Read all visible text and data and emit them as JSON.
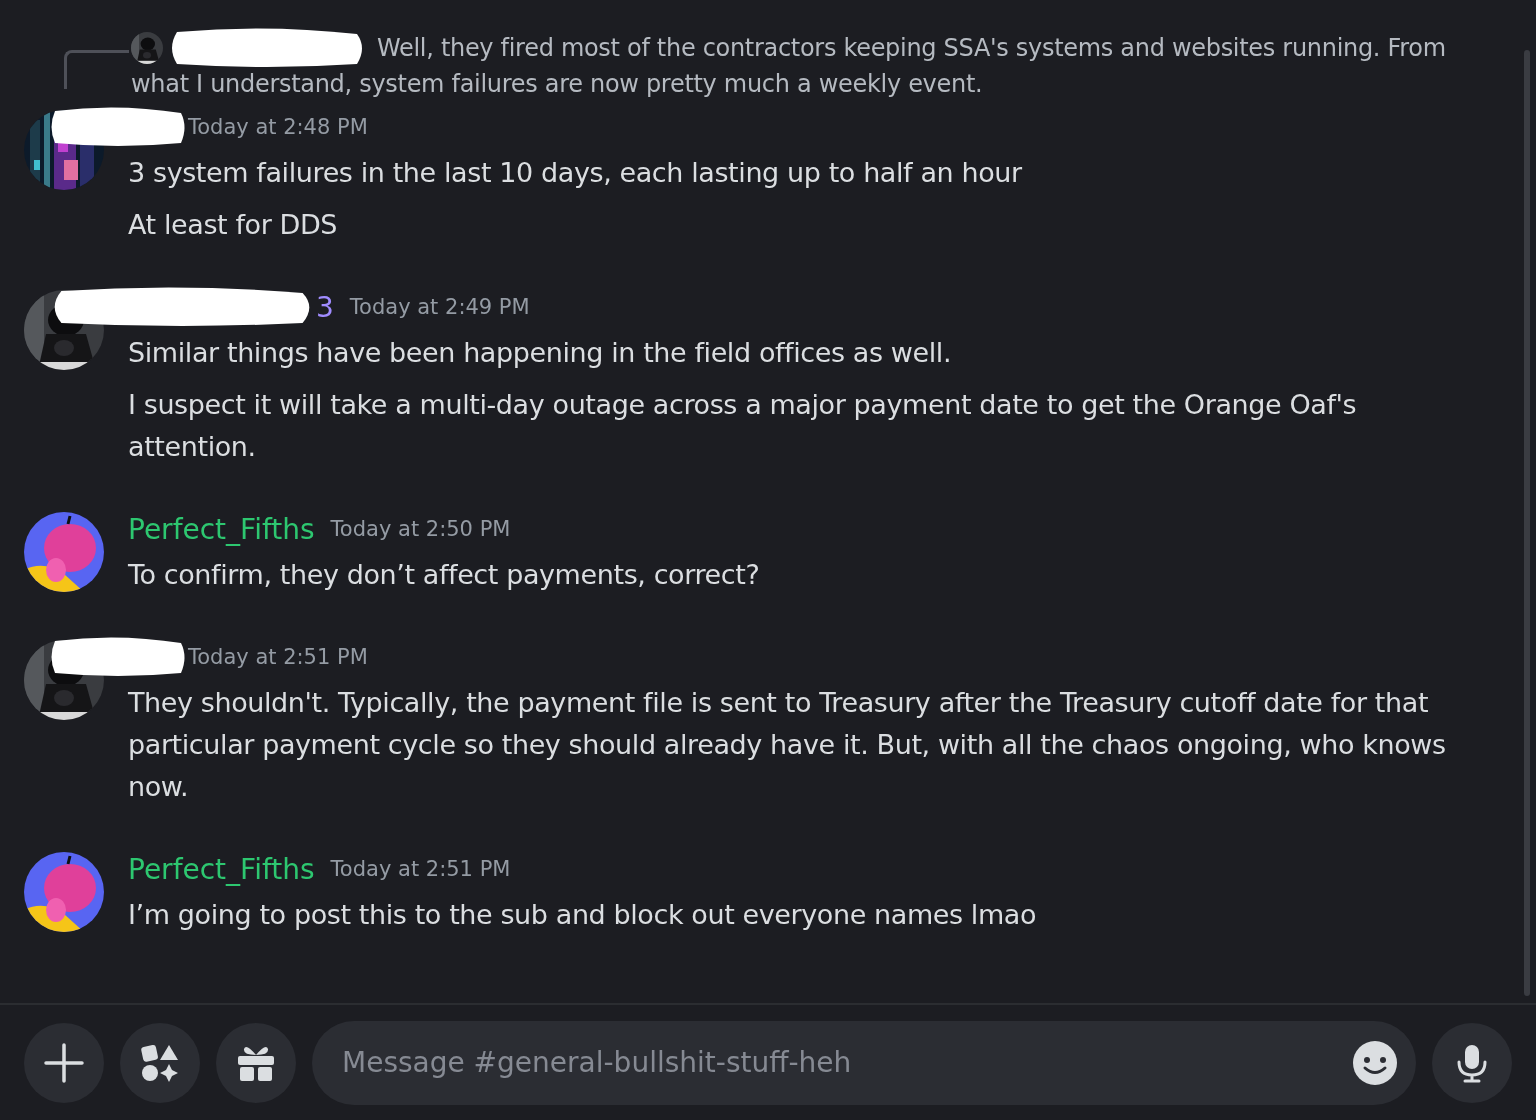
{
  "messages": [
    {
      "reply": {
        "text": "Well, they fired most of the contractors keeping SSA's systems and websites running.   From what I understand, system failures are now pretty much a weekly event.",
        "redacted": true
      },
      "redacted": true,
      "timestamp": "Today at 2:48 PM",
      "lines": [
        "3 system failures in the last 10 days, each lasting up to half an hour",
        "At least for DDS"
      ]
    },
    {
      "redacted": true,
      "author": {
        "name": "3",
        "color": "#a08cff"
      },
      "timestamp": "Today at 2:49 PM",
      "lines": [
        "Similar things have been happening in the field offices as well.",
        "I suspect it will take a multi-day outage across a major payment date to get the Orange Oaf's attention."
      ]
    },
    {
      "redacted": false,
      "author": {
        "name": "Perfect_Fifths",
        "color": "#2dc770"
      },
      "timestamp": "Today at 2:50 PM",
      "lines": [
        "To confirm, they don’t affect payments, correct?"
      ]
    },
    {
      "redacted": true,
      "timestamp": "Today at 2:51 PM",
      "lines": [
        "They shouldn't.   Typically, the payment file is sent to Treasury after the Treasury cutoff date for that particular payment cycle so they should already have it.   But, with all the chaos ongoing, who knows now."
      ]
    },
    {
      "redacted": false,
      "author": {
        "name": "Perfect_Fifths",
        "color": "#2dc770"
      },
      "timestamp": "Today at 2:51 PM",
      "lines": [
        "I’m going to post this to the sub and block out everyone names lmao"
      ]
    }
  ],
  "composer": {
    "placeholder": "Message #general-bullshit-stuff-heh"
  }
}
